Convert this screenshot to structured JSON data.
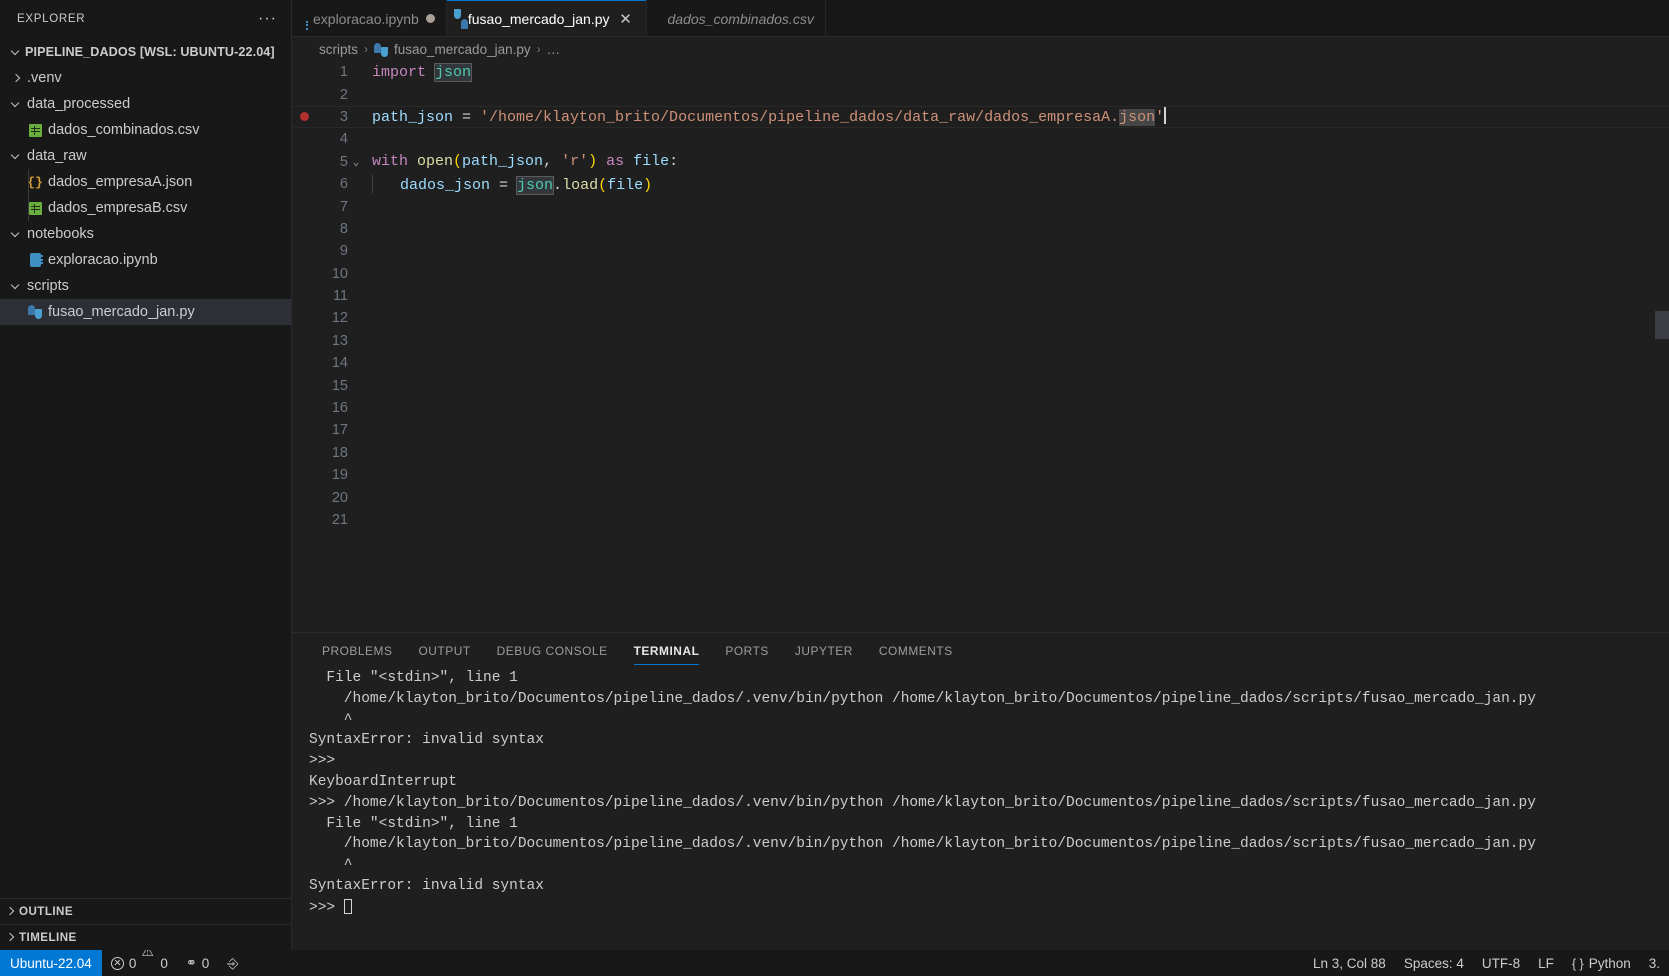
{
  "sidebar": {
    "title": "EXPLORER",
    "more_label": "···",
    "root": "PIPELINE_DADOS [WSL: UBUNTU-22.04]",
    "items": [
      {
        "label": ".venv",
        "icon": "folder-icon",
        "expanded": false,
        "depth": 1
      },
      {
        "label": "data_processed",
        "icon": "folder-icon",
        "expanded": true,
        "depth": 1
      },
      {
        "label": "dados_combinados.csv",
        "icon": "csv-file-icon",
        "depth": 2
      },
      {
        "label": "data_raw",
        "icon": "folder-icon",
        "expanded": true,
        "depth": 1
      },
      {
        "label": "dados_empresaA.json",
        "icon": "json-file-icon",
        "depth": 2
      },
      {
        "label": "dados_empresaB.csv",
        "icon": "csv-file-icon",
        "depth": 2
      },
      {
        "label": "notebooks",
        "icon": "folder-icon",
        "expanded": true,
        "depth": 1
      },
      {
        "label": "exploracao.ipynb",
        "icon": "notebook-file-icon",
        "depth": 2
      },
      {
        "label": "scripts",
        "icon": "folder-icon",
        "expanded": true,
        "depth": 1
      },
      {
        "label": "fusao_mercado_jan.py",
        "icon": "python-file-icon",
        "depth": 2,
        "selected": true
      }
    ],
    "sections": [
      {
        "label": "OUTLINE",
        "expanded": false
      },
      {
        "label": "TIMELINE",
        "expanded": false
      }
    ]
  },
  "tabs": [
    {
      "label": "exploracao.ipynb",
      "icon": "notebook-file-icon",
      "active": false,
      "dirty": true,
      "italic": false
    },
    {
      "label": "fusao_mercado_jan.py",
      "icon": "python-file-icon",
      "active": true,
      "dirty": false,
      "italic": false,
      "close": "✕"
    },
    {
      "label": "dados_combinados.csv",
      "icon": "csv-file-icon",
      "active": false,
      "dirty": false,
      "italic": true
    }
  ],
  "breadcrumb": {
    "folder": "scripts",
    "file": "fusao_mercado_jan.py",
    "tail": "…",
    "separator": "›"
  },
  "editor": {
    "language": "Python",
    "lines": [
      {
        "n": "1",
        "segments": [
          {
            "t": "import ",
            "c": "tk-kw"
          },
          {
            "t": "json",
            "c": "tk-type hl"
          }
        ]
      },
      {
        "n": "2",
        "segments": []
      },
      {
        "n": "3",
        "breakpoint": true,
        "active": true,
        "segments": [
          {
            "t": "path_json",
            "c": "tk-var"
          },
          {
            "t": " = ",
            "c": "tk-op"
          },
          {
            "t": "'/home/klayton_brito/Documentos/pipeline_dados/data_raw/dados_empresaA.",
            "c": "tk-str"
          },
          {
            "t": "json",
            "c": "tk-str hl-sel"
          },
          {
            "t": "'",
            "c": "tk-str"
          }
        ],
        "cursor": true
      },
      {
        "n": "4",
        "segments": []
      },
      {
        "n": "5",
        "fold": "⌄",
        "segments": [
          {
            "t": "with ",
            "c": "tk-kw"
          },
          {
            "t": "open",
            "c": "tk-fn"
          },
          {
            "t": "(",
            "c": "tk-punc"
          },
          {
            "t": "path_json",
            "c": "tk-var"
          },
          {
            "t": ", ",
            "c": "tk-op"
          },
          {
            "t": "'r'",
            "c": "tk-str"
          },
          {
            "t": ")",
            "c": "tk-punc"
          },
          {
            "t": " as ",
            "c": "tk-kw"
          },
          {
            "t": "file",
            "c": "tk-var"
          },
          {
            "t": ":",
            "c": "tk-op"
          }
        ]
      },
      {
        "n": "6",
        "indentGuide": true,
        "segments": [
          {
            "t": "dados_json",
            "c": "tk-var"
          },
          {
            "t": " = ",
            "c": "tk-op"
          },
          {
            "t": "json",
            "c": "tk-type hl"
          },
          {
            "t": ".",
            "c": "tk-op"
          },
          {
            "t": "load",
            "c": "tk-fn"
          },
          {
            "t": "(",
            "c": "tk-punc"
          },
          {
            "t": "file",
            "c": "tk-var"
          },
          {
            "t": ")",
            "c": "tk-punc"
          }
        ]
      },
      {
        "n": "7",
        "segments": []
      },
      {
        "n": "8",
        "segments": []
      },
      {
        "n": "9",
        "segments": []
      },
      {
        "n": "10",
        "segments": []
      },
      {
        "n": "11",
        "segments": []
      },
      {
        "n": "12",
        "segments": []
      },
      {
        "n": "13",
        "segments": []
      },
      {
        "n": "14",
        "segments": []
      },
      {
        "n": "15",
        "segments": []
      },
      {
        "n": "16",
        "segments": []
      },
      {
        "n": "17",
        "segments": []
      },
      {
        "n": "18",
        "segments": []
      },
      {
        "n": "19",
        "segments": []
      },
      {
        "n": "20",
        "segments": []
      },
      {
        "n": "21",
        "segments": []
      }
    ]
  },
  "panel": {
    "tabs": [
      {
        "label": "PROBLEMS",
        "active": false
      },
      {
        "label": "OUTPUT",
        "active": false
      },
      {
        "label": "DEBUG CONSOLE",
        "active": false
      },
      {
        "label": "TERMINAL",
        "active": true
      },
      {
        "label": "PORTS",
        "active": false
      },
      {
        "label": "JUPYTER",
        "active": false
      },
      {
        "label": "COMMENTS",
        "active": false
      }
    ],
    "terminal_lines": [
      "  File \"<stdin>\", line 1",
      "    /home/klayton_brito/Documentos/pipeline_dados/.venv/bin/python /home/klayton_brito/Documentos/pipeline_dados/scripts/fusao_mercado_jan.py",
      "    ^",
      "SyntaxError: invalid syntax",
      ">>>",
      "KeyboardInterrupt",
      ">>> /home/klayton_brito/Documentos/pipeline_dados/.venv/bin/python /home/klayton_brito/Documentos/pipeline_dados/scripts/fusao_mercado_jan.py",
      "  File \"<stdin>\", line 1",
      "    /home/klayton_brito/Documentos/pipeline_dados/.venv/bin/python /home/klayton_brito/Documentos/pipeline_dados/scripts/fusao_mercado_jan.py",
      "    ^",
      "SyntaxError: invalid syntax"
    ],
    "prompt": ">>> "
  },
  "statusbar": {
    "remote": "Ubuntu-22.04",
    "errors": "0",
    "warnings": "0",
    "ports": "0",
    "cursor_position": "Ln 3, Col 88",
    "indentation": "Spaces: 4",
    "encoding": "UTF-8",
    "eol": "LF",
    "language": "Python",
    "version": "3."
  },
  "colors": {
    "accent": "#0078d4",
    "editor_bg": "#1f1f1f",
    "sidebar_bg": "#181818",
    "breakpoint": "#b5302f",
    "string": "#ce9178",
    "keyword": "#c586c0",
    "type": "#4ec9b0",
    "variable": "#9cdcfe",
    "function": "#dcdcaa"
  }
}
